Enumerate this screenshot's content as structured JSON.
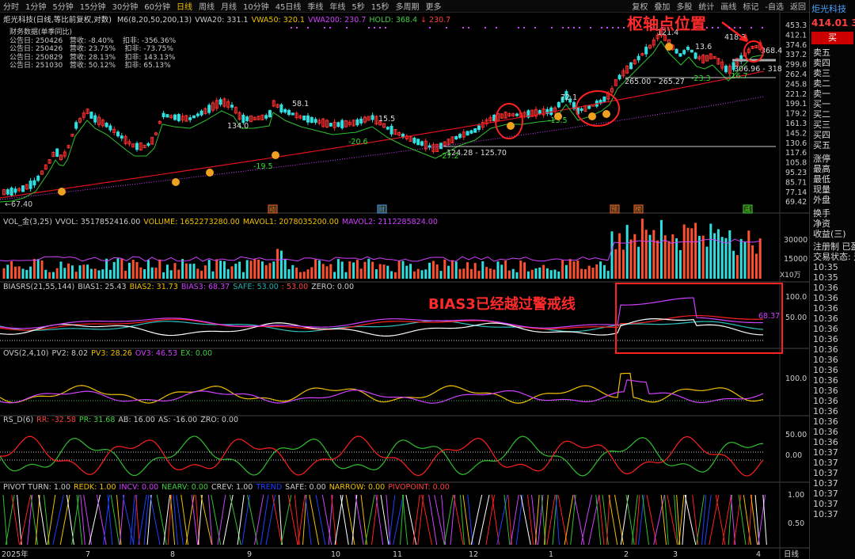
{
  "toolbar": {
    "periods": [
      "分时",
      "1分钟",
      "5分钟",
      "15分钟",
      "30分钟",
      "60分钟",
      "日线",
      "周线",
      "月线",
      "10分钟",
      "45日线",
      "季线",
      "年线",
      "5秒",
      "15秒",
      "多周期",
      "更多"
    ],
    "active_period": "日线",
    "right_items": [
      "复权",
      "叠加",
      "多股",
      "统计",
      "画线",
      "标记",
      "-自选",
      "返回"
    ]
  },
  "main_chart": {
    "header_name": "炬光科技(日线,等比前复权,对数)",
    "indicators": [
      {
        "text": "M6(8,20,50,200,13)",
        "color": "#cccccc"
      },
      {
        "text": "VWA20: 331.1",
        "color": "#cccccc"
      },
      {
        "text": "VWA50: 320.1",
        "color": "#f0c000"
      },
      {
        "text": "VWA200: 230.7",
        "color": "#d040ff"
      },
      {
        "text": "HOLD: 368.4",
        "color": "#40d040"
      },
      {
        "text": "↓ 230.7",
        "color": "#ff4040"
      }
    ],
    "finance_title": "财务数据(单季同比)",
    "finance_rows": [
      "公告日: 250426   营收: -8.40%    扣非: -356.36%",
      "公告日: 250426   营收: 23.75%    扣非: -73.75%",
      "公告日: 250829   营收: 28.13%    扣非: 143.13%",
      "公告日: 251030   营收: 50.12%    扣非: 65.13%"
    ],
    "price_labels": [
      "←67.40",
      "134.0",
      "58.1",
      "-19.5",
      "-20.6",
      "15.5",
      "124.28 - 125.70",
      "-27.2",
      "72.1",
      "-13.5",
      "265.00 - 265.27",
      "121.4",
      "13.6",
      "-23.3",
      "306.96 - 318",
      "418.3",
      "-16.7",
      "368.4"
    ],
    "y_ticks": [
      "453.3",
      "412.1",
      "374.6",
      "337.2",
      "299.8",
      "262.4",
      "245.8",
      "221.2",
      "199.1",
      "179.2",
      "161.3",
      "145.2",
      "130.6",
      "117.6",
      "105.8",
      "95.23",
      "85.71",
      "77.14",
      "69.42"
    ],
    "event_tags": [
      "动",
      "财",
      "预",
      "榜",
      "减"
    ]
  },
  "volume": {
    "header": [
      {
        "text": "VOL_金(3,25)",
        "color": "#cccccc"
      },
      {
        "text": "VVOL: 3517852416.00",
        "color": "#cccccc"
      },
      {
        "text": "VOLUME: 1652273280.00",
        "color": "#f0c000"
      },
      {
        "text": "MAVOL1: 2078035200.00",
        "color": "#f0c000"
      },
      {
        "text": "MAVOL2: 2112285824.00",
        "color": "#d040ff"
      }
    ],
    "y_ticks": [
      "30000",
      "15000"
    ],
    "unit": "X10万"
  },
  "bias": {
    "header": [
      {
        "text": "BIASRS(21,55,144)",
        "color": "#cccccc"
      },
      {
        "text": "BIAS1: 25.43",
        "color": "#cccccc"
      },
      {
        "text": "BIAS2: 31.73",
        "color": "#f0c000"
      },
      {
        "text": "BIAS3: 68.37",
        "color": "#d040ff"
      },
      {
        "text": "SAFE: 53.00",
        "color": "#20b0b0"
      },
      {
        "text": ": 53.00",
        "color": "#ff4040"
      },
      {
        "text": "ZERO: 0.00",
        "color": "#cccccc"
      }
    ],
    "y_ticks": [
      "100.0",
      "50.00"
    ],
    "last_value": "68.37"
  },
  "ovs": {
    "header": [
      {
        "text": "OVS(2,4,10)",
        "color": "#cccccc"
      },
      {
        "text": "PV2: 8.02",
        "color": "#cccccc"
      },
      {
        "text": "PV3: 28.26",
        "color": "#f0c000"
      },
      {
        "text": "OV3: 46.53",
        "color": "#d040ff"
      },
      {
        "text": "EX: 0.00",
        "color": "#40d040"
      }
    ],
    "y_ticks": [
      "100.0"
    ]
  },
  "rsd": {
    "header": [
      {
        "text": "RS_D(6)",
        "color": "#cccccc"
      },
      {
        "text": "RR: -32.58",
        "color": "#ff4040"
      },
      {
        "text": "PR: 31.68",
        "color": "#40d040"
      },
      {
        "text": "AB: 16.00",
        "color": "#cccccc"
      },
      {
        "text": "AS: -16.00",
        "color": "#cccccc"
      },
      {
        "text": "ZRO: 0.00",
        "color": "#cccccc"
      }
    ],
    "y_ticks": [
      "50.00",
      "0.00"
    ]
  },
  "pivot": {
    "header": [
      {
        "text": "PIVOT TURN: 1.00",
        "color": "#cccccc"
      },
      {
        "text": "REDK: 1.00",
        "color": "#f0c000"
      },
      {
        "text": "INCV: 0.00",
        "color": "#d040ff"
      },
      {
        "text": "NEARV: 0.00",
        "color": "#40d040"
      },
      {
        "text": "CREV: 1.00",
        "color": "#cccccc"
      },
      {
        "text": "TREND",
        "color": "#2040ff"
      },
      {
        "text": "SAFE: 0.00",
        "color": "#cccccc"
      },
      {
        "text": "NARROW: 0.00",
        "color": "#f0c000"
      },
      {
        "text": "PIVOPOINT: 0.00",
        "color": "#ff4040"
      }
    ],
    "y_ticks": [
      "1.00",
      "0.50"
    ]
  },
  "x_axis": {
    "labels": [
      "2025年",
      "7",
      "8",
      "9",
      "10",
      "11",
      "12",
      "1",
      "2",
      "3",
      "4"
    ],
    "right_label": "日线"
  },
  "annotations": {
    "pivot_label": "枢轴点位置",
    "bias_label": "BIAS3已经越过警戒线"
  },
  "side_panel": {
    "stock_name": "炬光科技",
    "price": "414.01",
    "price_extra": "3",
    "buy_label": "买",
    "order_rows": [
      "卖五",
      "卖四",
      "卖三",
      "卖二",
      "卖一",
      "买一",
      "买二",
      "买三",
      "买四",
      "买五"
    ],
    "stats_rows": [
      "涨停",
      "最高",
      "最低",
      "现量",
      "外盘"
    ],
    "stats_rows2": [
      "换手",
      "净资",
      "收益(三)"
    ],
    "reg_row": "注册制  已盈",
    "status_row": "交易状态: 运",
    "times": [
      "10:35",
      "10:35",
      "10:36",
      "10:36",
      "10:36",
      "10:36",
      "10:36",
      "10:36",
      "10:36",
      "10:36",
      "10:36",
      "10:36",
      "10:36",
      "10:36",
      "10:36",
      "10:36",
      "10:36",
      "10:36",
      "10:37",
      "10:37",
      "10:37",
      "10:37",
      "10:37",
      "10:37",
      "10:37"
    ]
  },
  "colors": {
    "up": "#ff3030",
    "down": "#30e0e0",
    "annotation": "#ff2a2a"
  }
}
